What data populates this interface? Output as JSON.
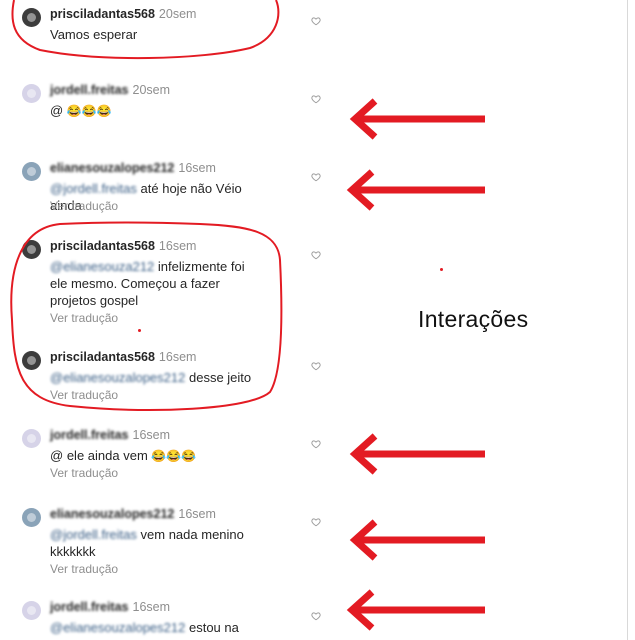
{
  "comments": [
    {
      "user": "prisciladantas568",
      "time": "20sem",
      "text": "Vamos esperar",
      "show_ver": false
    },
    {
      "user": "jordell.freitas",
      "time": "20sem",
      "mention": "@",
      "emoji": "😂😂😂",
      "show_ver": false
    },
    {
      "user": "elianesouzalopes212",
      "time": "16sem",
      "mention": "@jordell.freitas",
      "text": "até hoje não Véio ainda",
      "ver": "Ver tradução"
    },
    {
      "user": "prisciladantas568",
      "time": "16sem",
      "mention": "@elianesouza212",
      "text": "infelizmente foi ele mesmo. Começou a fazer projetos gospel",
      "ver": "Ver tradução"
    },
    {
      "user": "prisciladantas568",
      "time": "16sem",
      "mention": "@elianesouzalopes212",
      "text": "desse jeito",
      "ver": "Ver tradução"
    },
    {
      "user": "jordell.freitas",
      "time": "16sem",
      "mention": "@",
      "text": "ele ainda vem",
      "emoji": "😂😂😂",
      "ver": "Ver tradução"
    },
    {
      "user": "elianesouzalopes212",
      "time": "16sem",
      "mention": "@jordell.freitas",
      "text": "vem nada menino kkkkkkk",
      "ver": "Ver tradução"
    },
    {
      "user": "jordell.freitas",
      "time": "16sem",
      "mention": "@elianesouzalopes212",
      "text": "estou na",
      "ver": ""
    }
  ],
  "annotation": {
    "label": "Interações"
  },
  "colors": {
    "red": "#e31b23",
    "username": "#262626",
    "muted": "#8e8e8e",
    "mention": "#3b5f86"
  },
  "icons": {
    "like": "heart-outline-icon",
    "pointer": "left-arrow-icon"
  }
}
